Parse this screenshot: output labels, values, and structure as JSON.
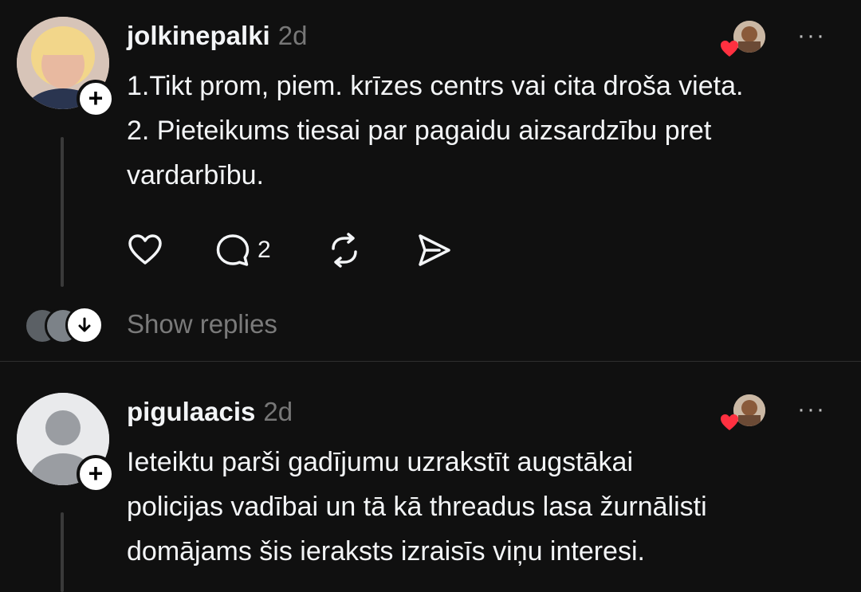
{
  "posts": [
    {
      "username": "jolkinepalki",
      "time": "2d",
      "lines": [
        "1.Tikt prom, piem. krīzes centrs vai cita droša vieta.",
        "2. Pieteikums tiesai par pagaidu aizsardzību pret",
        "vardarbību."
      ],
      "reply_count": "2",
      "show_replies": "Show replies",
      "more": "···"
    },
    {
      "username": "pigulaacis",
      "time": "2d",
      "lines": [
        "Ieteiktu parši gadījumu uzrakstīt augstākai",
        "policijas vadībai un tā kā threadus lasa žurnālisti",
        "domājams šis ieraksts izraisīs viņu interesi."
      ],
      "more": "···"
    }
  ],
  "icons": {
    "follow": "plus-icon",
    "like": "heart-icon",
    "reply": "comment-icon",
    "repost": "repost-icon",
    "share": "send-icon",
    "liked": "liked-heart-icon",
    "expand": "arrow-down-icon"
  },
  "colors": {
    "background": "#101010",
    "text": "#f3f5f7",
    "muted": "#777777",
    "heart": "#ff3040"
  }
}
